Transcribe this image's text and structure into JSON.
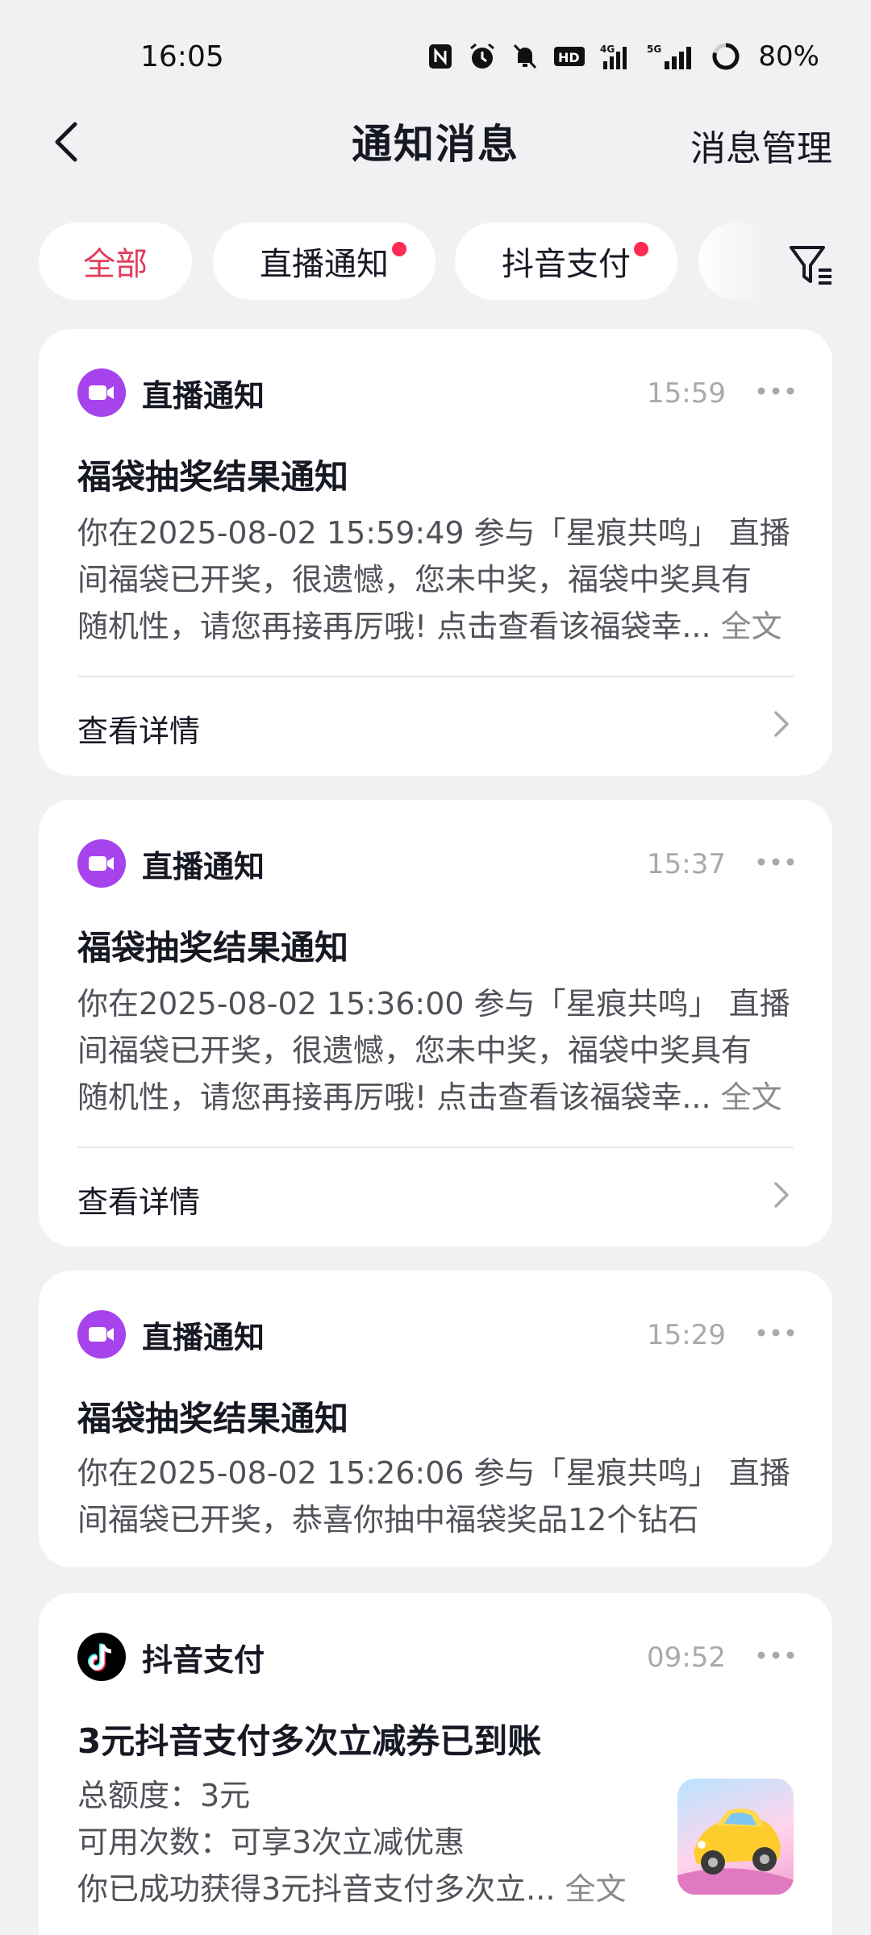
{
  "status_bar": {
    "time": "16:05",
    "battery": "80%",
    "icons": [
      "nfc-icon",
      "alarm-icon",
      "mute-icon",
      "hd-icon",
      "signal-4g-icon",
      "signal-5g-icon",
      "battery-ring-icon"
    ]
  },
  "nav": {
    "title": "通知消息",
    "manage_label": "消息管理"
  },
  "tabs": [
    {
      "label": "全部",
      "active": true,
      "dot": false
    },
    {
      "label": "直播通知",
      "active": false,
      "dot": true
    },
    {
      "label": "抖音支付",
      "active": false,
      "dot": true
    }
  ],
  "cards": [
    {
      "source": "直播通知",
      "time": "15:59",
      "title": "福袋抽奖结果通知",
      "lines": [
        "  你在2025-08-02 15:59:49 参与「星痕共鸣」 直播",
        "间福袋已开奖，很遗憾，您未中奖，福袋中奖具有",
        "随机性，请您再接再厉哦! 点击查看该福袋幸..."
      ],
      "full_text": "全文",
      "detail": "查看详情"
    },
    {
      "source": "直播通知",
      "time": "15:37",
      "title": "福袋抽奖结果通知",
      "lines": [
        "  你在2025-08-02 15:36:00 参与「星痕共鸣」 直播",
        "间福袋已开奖，很遗憾，您未中奖，福袋中奖具有",
        "随机性，请您再接再厉哦! 点击查看该福袋幸..."
      ],
      "full_text": "全文",
      "detail": "查看详情"
    },
    {
      "source": "直播通知",
      "time": "15:29",
      "title": "福袋抽奖结果通知",
      "lines": [
        "  你在2025-08-02 15:26:06 参与「星痕共鸣」 直播",
        "间福袋已开奖，恭喜你抽中福袋奖品12个钻石"
      ]
    },
    {
      "source": "抖音支付",
      "time": "09:52",
      "title": "3元抖音支付多次立减券已到账",
      "lines": [
        "总额度：3元",
        "可用次数：可享3次立减优惠",
        "你已成功获得3元抖音支付多次立..."
      ],
      "full_text": "全文"
    }
  ],
  "colors": {
    "background": "#f1f1f3",
    "accent_red": "#e23c5a",
    "dot_red": "#fe2c55",
    "live_purple": "#a743ec",
    "muted_text": "#a8a9ad"
  }
}
